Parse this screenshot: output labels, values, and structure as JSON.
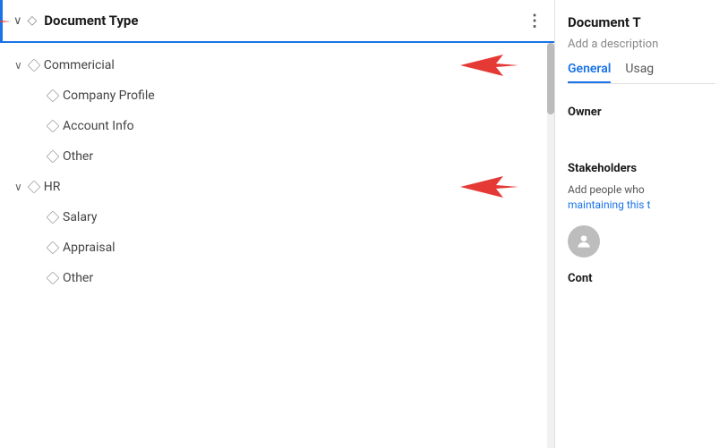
{
  "header": {
    "title": "Document Type",
    "more_label": "⋮"
  },
  "tree": {
    "items": [
      {
        "id": "commercial",
        "label": "Commericial",
        "level": 0,
        "hasChevron": true,
        "expanded": true
      },
      {
        "id": "company-profile",
        "label": "Company Profile",
        "level": 1,
        "hasChevron": false,
        "expanded": false
      },
      {
        "id": "account-info",
        "label": "Account Info",
        "level": 1,
        "hasChevron": false,
        "expanded": false
      },
      {
        "id": "other-commercial",
        "label": "Other",
        "level": 1,
        "hasChevron": false,
        "expanded": false
      },
      {
        "id": "hr",
        "label": "HR",
        "level": 0,
        "hasChevron": true,
        "expanded": true
      },
      {
        "id": "salary",
        "label": "Salary",
        "level": 1,
        "hasChevron": false,
        "expanded": false
      },
      {
        "id": "appraisal",
        "label": "Appraisal",
        "level": 1,
        "hasChevron": false,
        "expanded": false
      },
      {
        "id": "other-hr",
        "label": "Other",
        "level": 1,
        "hasChevron": false,
        "expanded": false
      }
    ]
  },
  "right_panel": {
    "doc_title": "Document T",
    "doc_subtitle": "Add a description",
    "tabs": [
      {
        "label": "General",
        "active": true
      },
      {
        "label": "Usag",
        "active": false
      }
    ],
    "owner_label": "Owner",
    "stakeholders_label": "Stakeholders",
    "stakeholders_desc": "Add people who",
    "stakeholders_desc2": "maintaining this t",
    "bottom_label": "Cont"
  }
}
